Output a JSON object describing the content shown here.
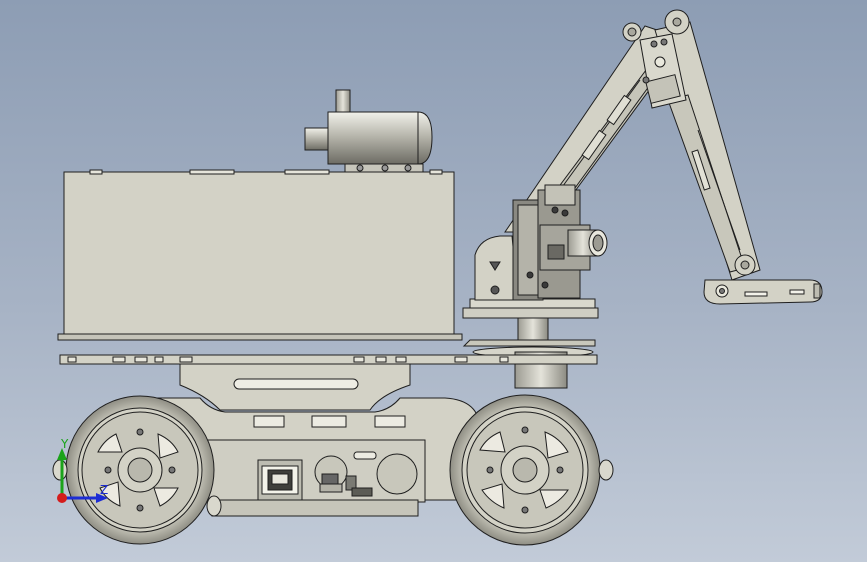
{
  "scene": {
    "subject": "mobile-robot-cad-model",
    "view": "side-orthographic",
    "background_top": "#8d9db4",
    "background_bottom": "#c2cbd8",
    "part_color": "#d3d2c6",
    "edge_color": "#1f1f1f"
  },
  "triad": {
    "y_label": "Y",
    "z_label": "Z",
    "y_color": "#1aa31a",
    "z_color": "#1c2cd4",
    "x_color": "#d41c1c"
  }
}
